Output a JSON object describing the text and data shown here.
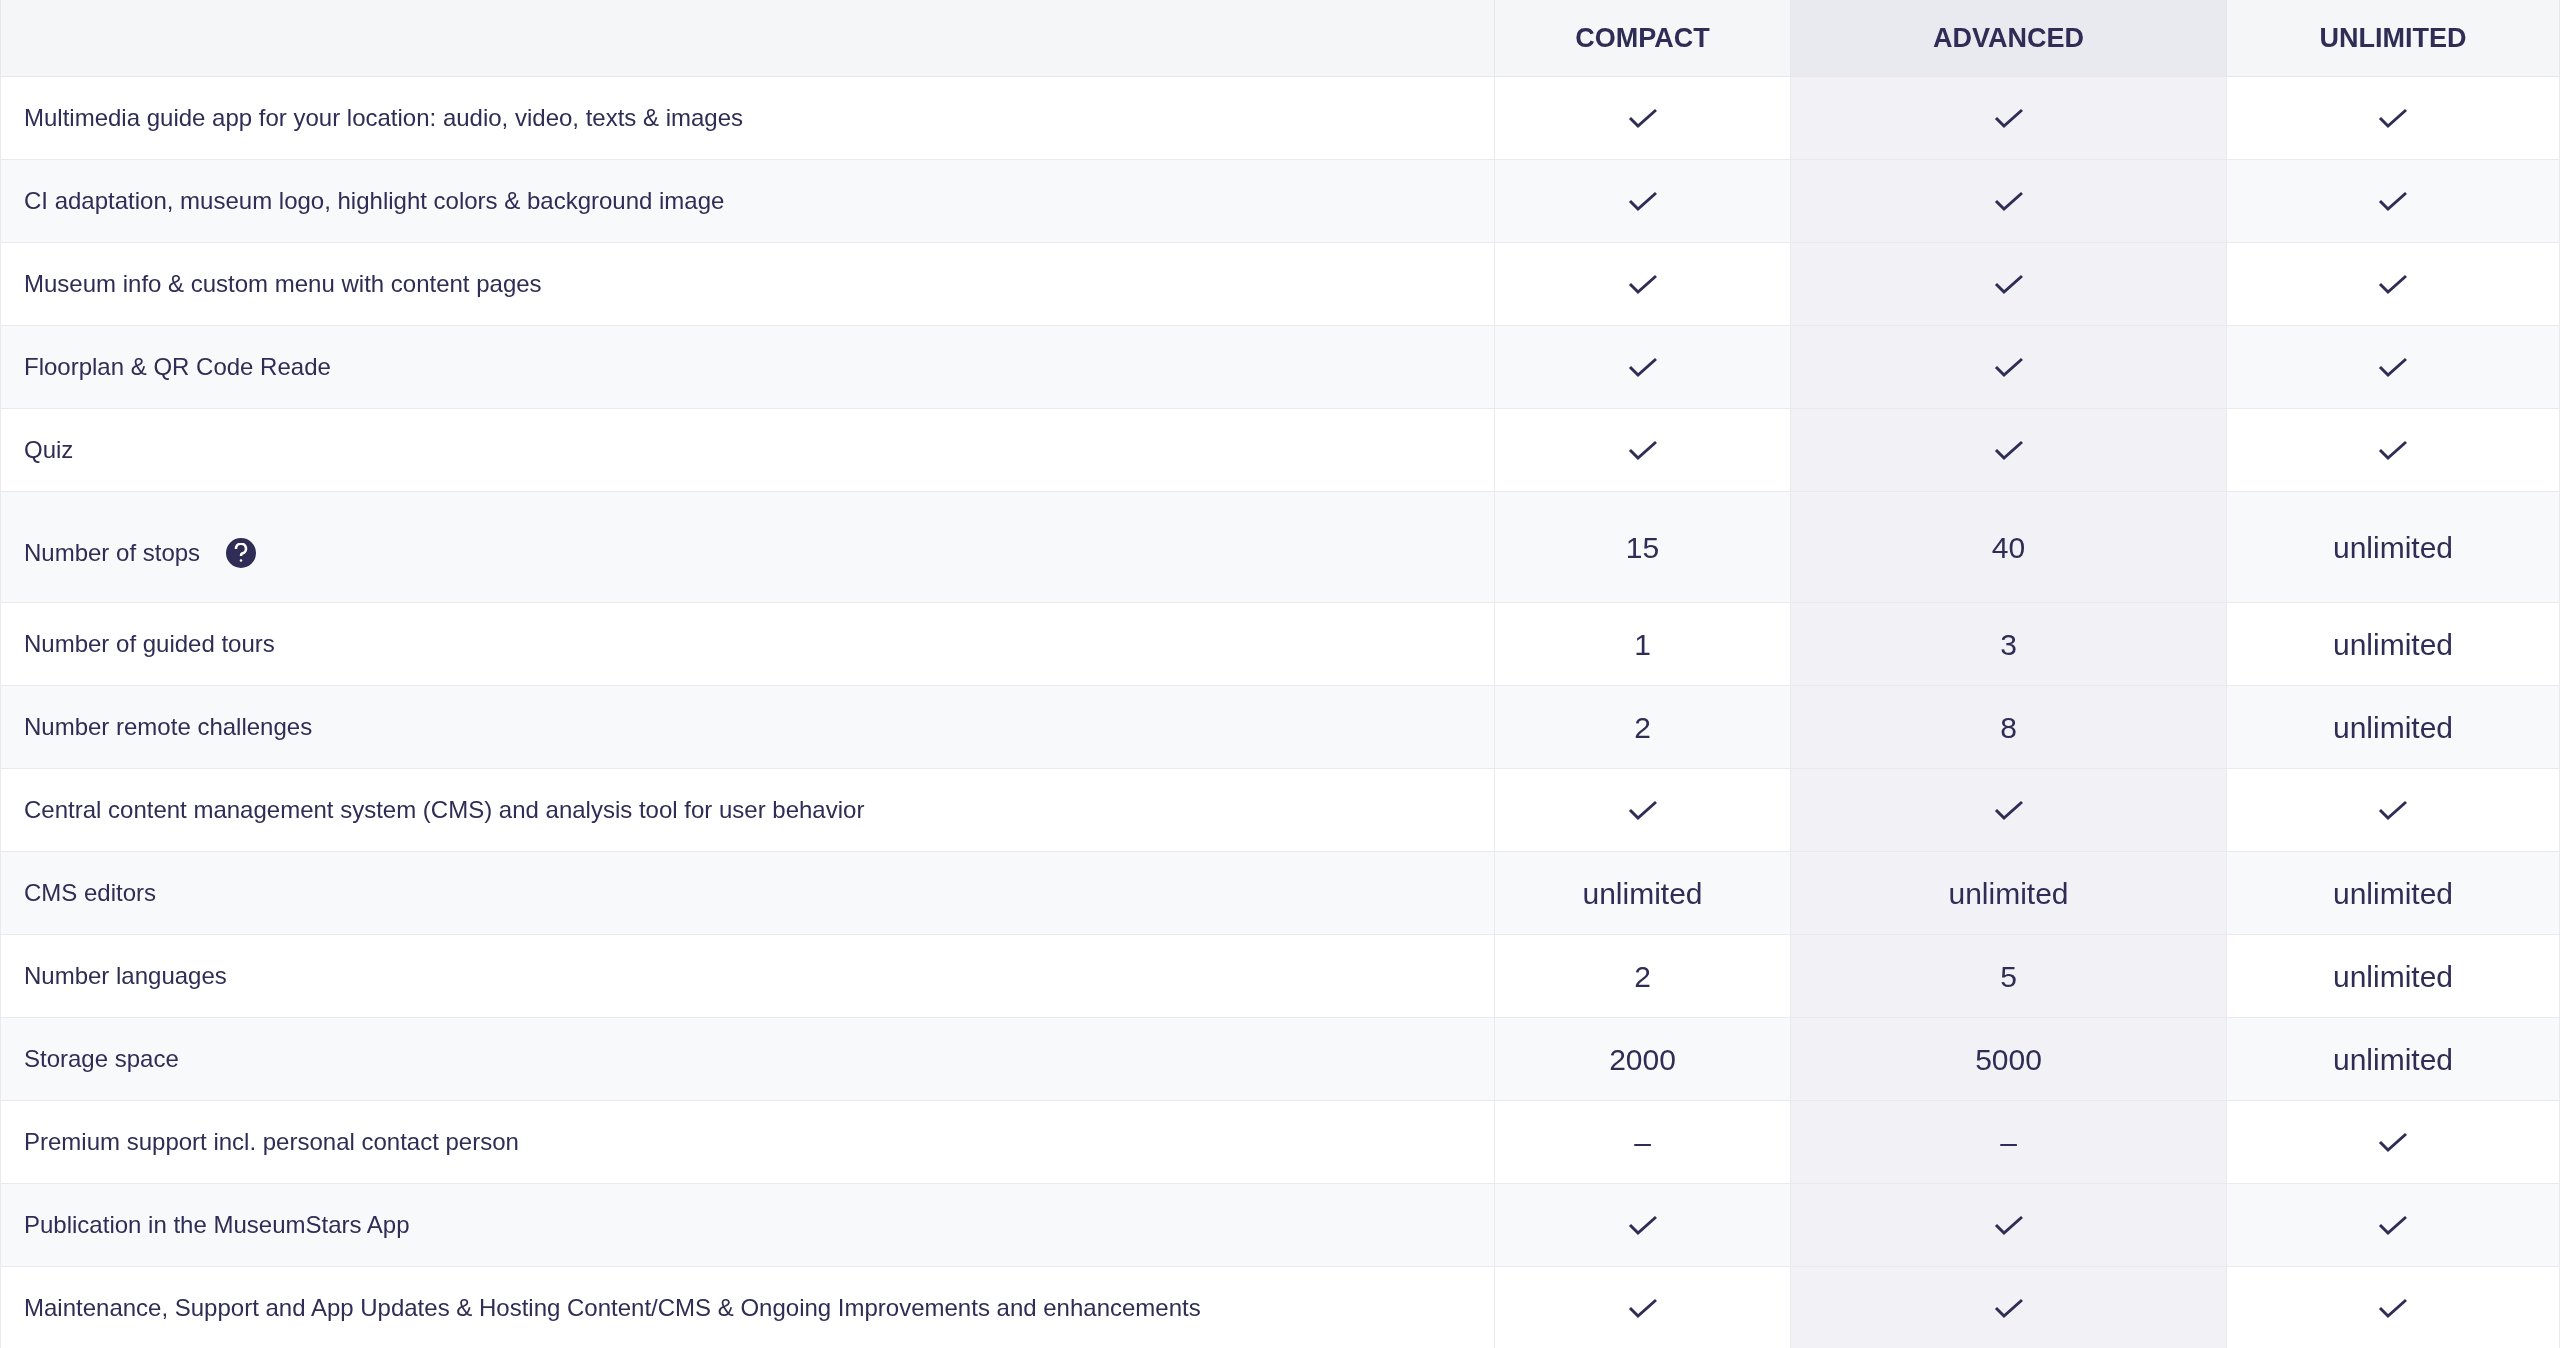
{
  "table": {
    "columns": [
      {
        "label": "COMPACT",
        "highlighted": false
      },
      {
        "label": "ADVANCED",
        "highlighted": true
      },
      {
        "label": "UNLIMITED",
        "highlighted": false
      }
    ],
    "rows": [
      {
        "feature": "Multimedia guide app for your location: audio, video, texts & images",
        "help": false,
        "cells": [
          {
            "kind": "check"
          },
          {
            "kind": "check"
          },
          {
            "kind": "check"
          }
        ]
      },
      {
        "feature": "CI adaptation, museum logo, highlight colors & background image",
        "help": false,
        "cells": [
          {
            "kind": "check"
          },
          {
            "kind": "check"
          },
          {
            "kind": "check"
          }
        ]
      },
      {
        "feature": "Museum info & custom menu with content pages",
        "help": false,
        "cells": [
          {
            "kind": "check"
          },
          {
            "kind": "check"
          },
          {
            "kind": "check"
          }
        ]
      },
      {
        "feature": "Floorplan & QR Code Reade",
        "help": false,
        "cells": [
          {
            "kind": "check"
          },
          {
            "kind": "check"
          },
          {
            "kind": "check"
          }
        ]
      },
      {
        "feature": "Quiz",
        "help": false,
        "cells": [
          {
            "kind": "check"
          },
          {
            "kind": "check"
          },
          {
            "kind": "check"
          }
        ]
      },
      {
        "feature": "Number of stops",
        "help": true,
        "cells": [
          {
            "kind": "text",
            "text": "15"
          },
          {
            "kind": "text",
            "text": "40"
          },
          {
            "kind": "text",
            "text": "unlimited"
          }
        ]
      },
      {
        "feature": "Number of guided tours",
        "help": false,
        "cells": [
          {
            "kind": "text",
            "text": "1"
          },
          {
            "kind": "text",
            "text": "3"
          },
          {
            "kind": "text",
            "text": "unlimited"
          }
        ]
      },
      {
        "feature": "Number remote challenges",
        "help": false,
        "cells": [
          {
            "kind": "text",
            "text": "2"
          },
          {
            "kind": "text",
            "text": "8"
          },
          {
            "kind": "text",
            "text": "unlimited"
          }
        ]
      },
      {
        "feature": "Central content management system (CMS) and analysis tool for user behavior",
        "help": false,
        "cells": [
          {
            "kind": "check"
          },
          {
            "kind": "check"
          },
          {
            "kind": "check"
          }
        ]
      },
      {
        "feature": "CMS editors",
        "help": false,
        "cells": [
          {
            "kind": "text",
            "text": "unlimited"
          },
          {
            "kind": "text",
            "text": "unlimited"
          },
          {
            "kind": "text",
            "text": "unlimited"
          }
        ]
      },
      {
        "feature": "Number languages",
        "help": false,
        "cells": [
          {
            "kind": "text",
            "text": "2"
          },
          {
            "kind": "text",
            "text": "5"
          },
          {
            "kind": "text",
            "text": "unlimited"
          }
        ]
      },
      {
        "feature": "Storage space",
        "help": false,
        "cells": [
          {
            "kind": "text",
            "text": "2000"
          },
          {
            "kind": "text",
            "text": "5000"
          },
          {
            "kind": "text",
            "text": "unlimited"
          }
        ]
      },
      {
        "feature": "Premium support incl. personal contact person",
        "help": false,
        "cells": [
          {
            "kind": "text",
            "text": "–"
          },
          {
            "kind": "text",
            "text": "–"
          },
          {
            "kind": "check"
          }
        ]
      },
      {
        "feature": "Publication in the MuseumStars App",
        "help": false,
        "cells": [
          {
            "kind": "check"
          },
          {
            "kind": "check"
          },
          {
            "kind": "check"
          }
        ]
      },
      {
        "feature": "Maintenance, Support and App Updates & Hosting Content/CMS & Ongoing Improvements and enhancements",
        "help": false,
        "cells": [
          {
            "kind": "check"
          },
          {
            "kind": "check"
          },
          {
            "kind": "check"
          }
        ]
      }
    ]
  }
}
